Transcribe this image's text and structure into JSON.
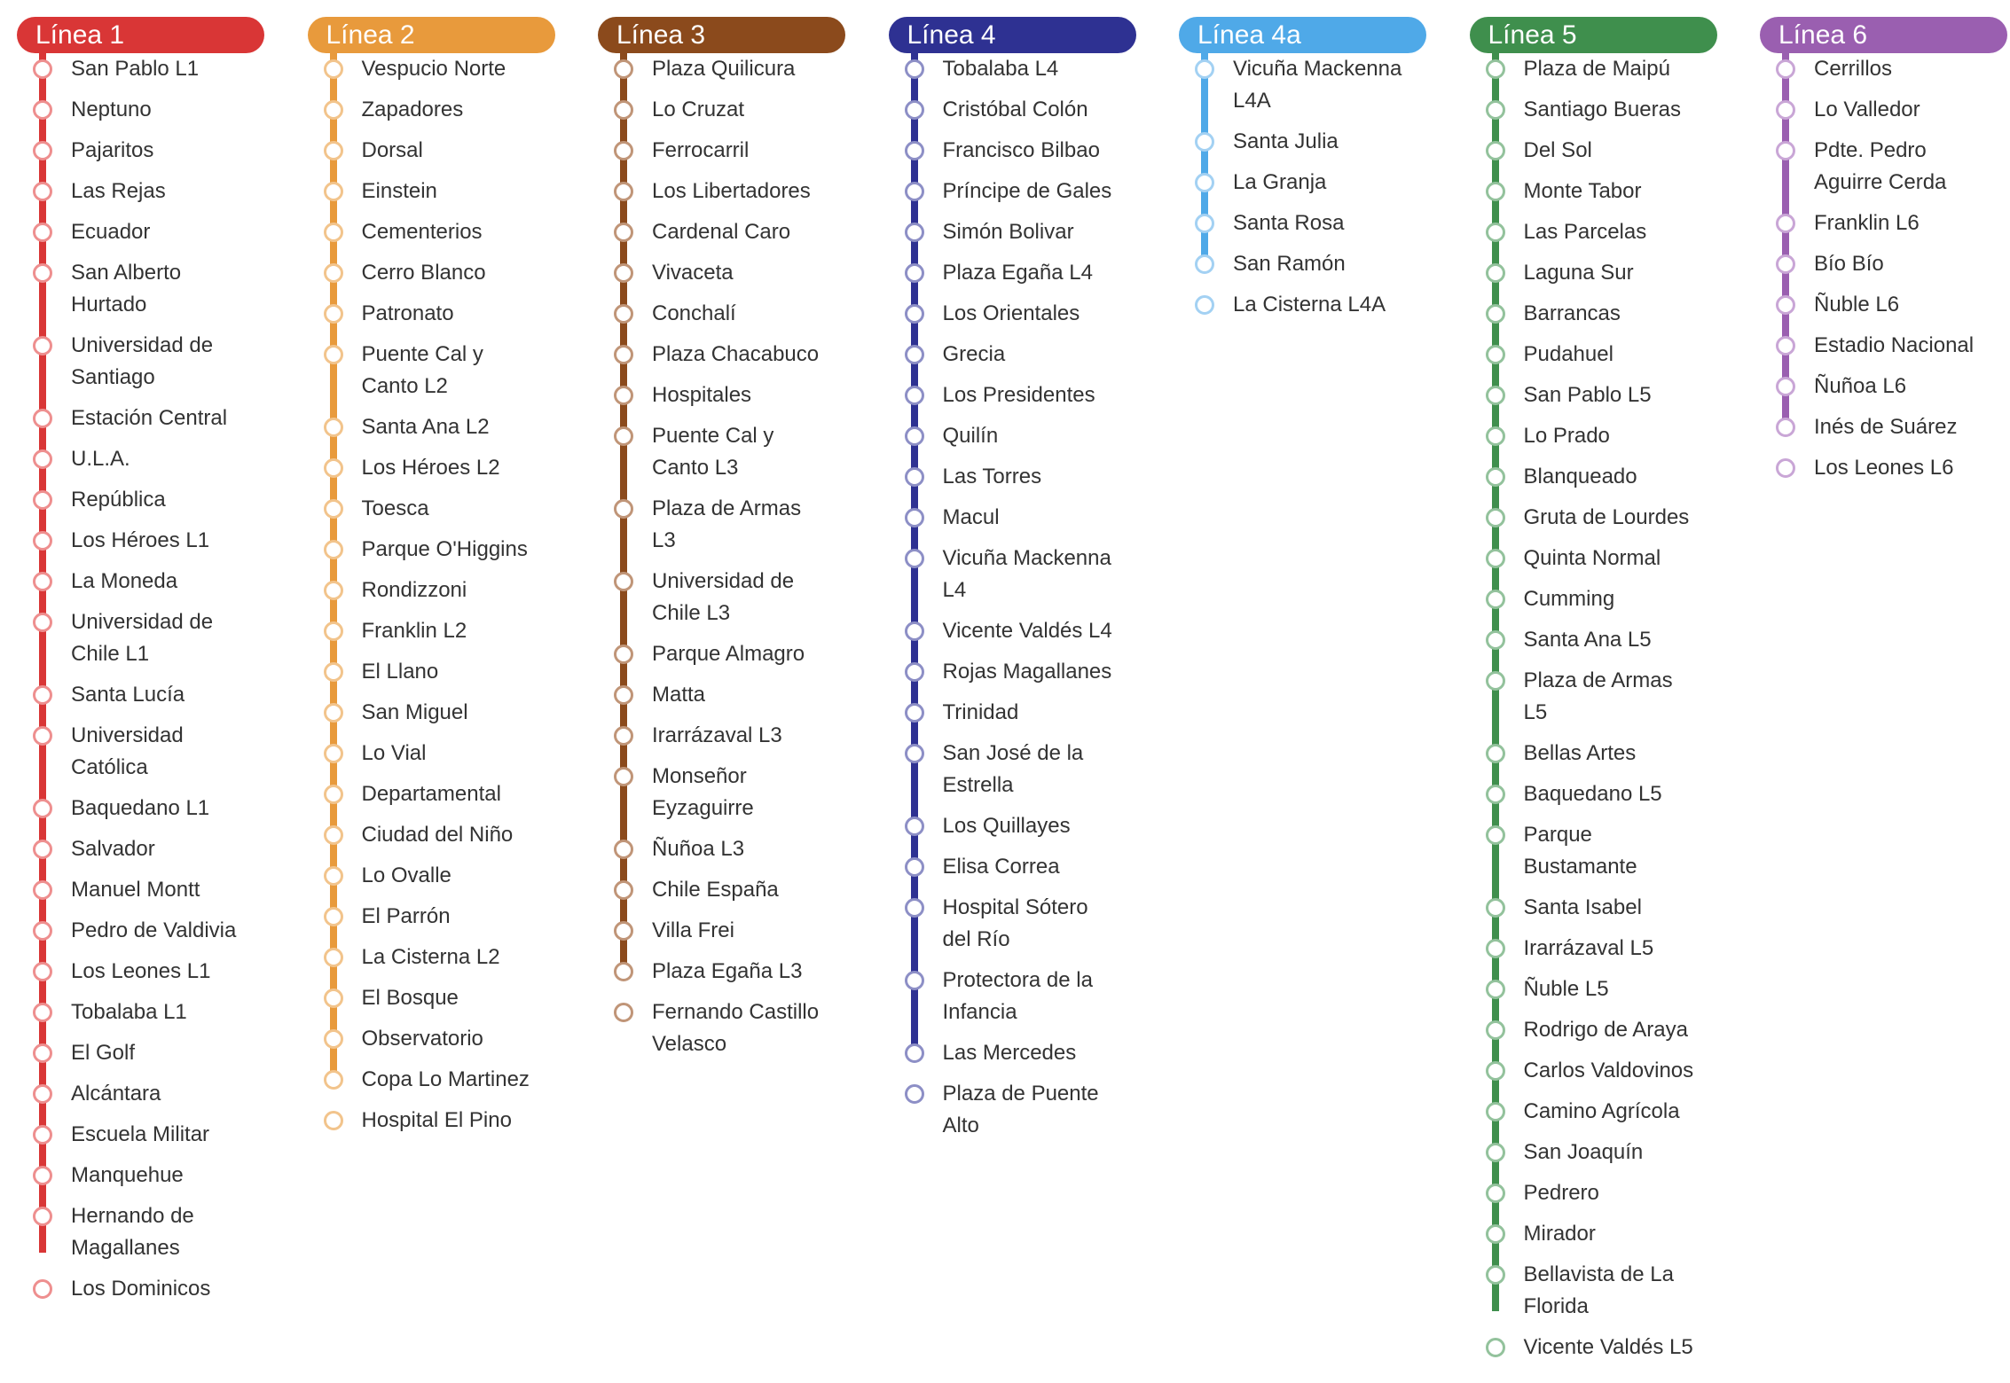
{
  "lines": [
    {
      "label": "Línea 1",
      "color": "#d93636",
      "dot": "#ee8f8f",
      "stations": [
        "San Pablo L1",
        "Neptuno",
        "Pajaritos",
        "Las Rejas",
        "Ecuador",
        "San Alberto\nHurtado",
        "Universidad de\nSantiago",
        "Estación Central",
        "U.L.A.",
        "República",
        "Los Héroes L1",
        "La Moneda",
        "Universidad de\nChile L1",
        "Santa Lucía",
        "Universidad\nCatólica",
        "Baquedano L1",
        "Salvador",
        "Manuel Montt",
        "Pedro de Valdivia",
        "Los Leones L1",
        "Tobalaba L1",
        "El Golf",
        "Alcántara",
        "Escuela Militar",
        "Manquehue",
        "Hernando de\nMagallanes",
        "Los Dominicos"
      ]
    },
    {
      "label": "Línea 2",
      "color": "#e89a3c",
      "dot": "#f2c48c",
      "stations": [
        "Vespucio Norte",
        "Zapadores",
        "Dorsal",
        "Einstein",
        "Cementerios",
        "Cerro Blanco",
        "Patronato",
        "Puente Cal y\nCanto L2",
        "Santa Ana L2",
        "Los Héroes L2",
        "Toesca",
        "Parque O'Higgins",
        "Rondizzoni",
        "Franklin L2",
        "El Llano",
        "San Miguel",
        "Lo Vial",
        "Departamental",
        "Ciudad del Niño",
        "Lo Ovalle",
        "El Parrón",
        "La Cisterna L2",
        "El Bosque",
        "Observatorio",
        "Copa Lo Martinez",
        "Hospital El Pino"
      ]
    },
    {
      "label": "Línea 3",
      "color": "#8b4a1c",
      "dot": "#c09578",
      "stations": [
        "Plaza Quilicura",
        "Lo Cruzat",
        "Ferrocarril",
        "Los Libertadores",
        "Cardenal Caro",
        "Vivaceta",
        "Conchalí",
        "Plaza Chacabuco",
        "Hospitales",
        "Puente Cal y\nCanto L3",
        "Plaza de Armas\nL3",
        "Universidad de\nChile L3",
        "Parque Almagro",
        "Matta",
        "Irarrázaval L3",
        "Monseñor\nEyzaguirre",
        "Ñuñoa L3",
        "Chile España",
        "Villa Frei",
        "Plaza Egaña L3",
        "Fernando Castillo\nVelasco"
      ]
    },
    {
      "label": "Línea 4",
      "color": "#2e3192",
      "dot": "#8d8fc6",
      "stations": [
        "Tobalaba L4",
        "Cristóbal Colón",
        "Francisco Bilbao",
        "Príncipe de Gales",
        "Simón Bolivar",
        "Plaza Egaña L4",
        "Los Orientales",
        "Grecia",
        "Los Presidentes",
        "Quilín",
        "Las Torres",
        "Macul",
        "Vicuña Mackenna\nL4",
        "Vicente Valdés L4",
        "Rojas Magallanes",
        "Trinidad",
        "San José de la\nEstrella",
        "Los Quillayes",
        "Elisa Correa",
        "Hospital Sótero\ndel Río",
        "Protectora de la\nInfancia",
        "Las Mercedes",
        "Plaza de Puente\nAlto"
      ]
    },
    {
      "label": "Línea 4a",
      "color": "#4fa9e8",
      "dot": "#a3d1f3",
      "stations": [
        "Vicuña Mackenna\nL4A",
        "Santa Julia",
        "La Granja",
        "Santa Rosa",
        "San Ramón",
        "La Cisterna L4A"
      ]
    },
    {
      "label": "Línea 5",
      "color": "#3f8f4d",
      "dot": "#93c29c",
      "stations": [
        "Plaza de Maipú",
        "Santiago Bueras",
        "Del Sol",
        "Monte Tabor",
        "Las Parcelas",
        "Laguna Sur",
        "Barrancas",
        "Pudahuel",
        "San Pablo L5",
        "Lo Prado",
        "Blanqueado",
        "Gruta de Lourdes",
        "Quinta Normal",
        "Cumming",
        "Santa Ana L5",
        "Plaza de Armas\nL5",
        "Bellas Artes",
        "Baquedano L5",
        "Parque\nBustamante",
        "Santa Isabel",
        "Irarrázaval L5",
        "Ñuble L5",
        "Rodrigo de Araya",
        "Carlos Valdovinos",
        "Camino Agrícola",
        "San Joaquín",
        "Pedrero",
        "Mirador",
        "Bellavista de La\nFlorida",
        "Vicente Valdés L5"
      ]
    },
    {
      "label": "Línea 6",
      "color": "#9a5fb0",
      "dot": "#c9a6d6",
      "stations": [
        "Cerrillos",
        "Lo Valledor",
        "Pdte. Pedro\nAguirre Cerda",
        "Franklin L6",
        "Bío Bío",
        "Ñuble L6",
        "Estadio Nacional",
        "Ñuñoa L6",
        "Inés de Suárez",
        "Los Leones L6"
      ]
    }
  ]
}
